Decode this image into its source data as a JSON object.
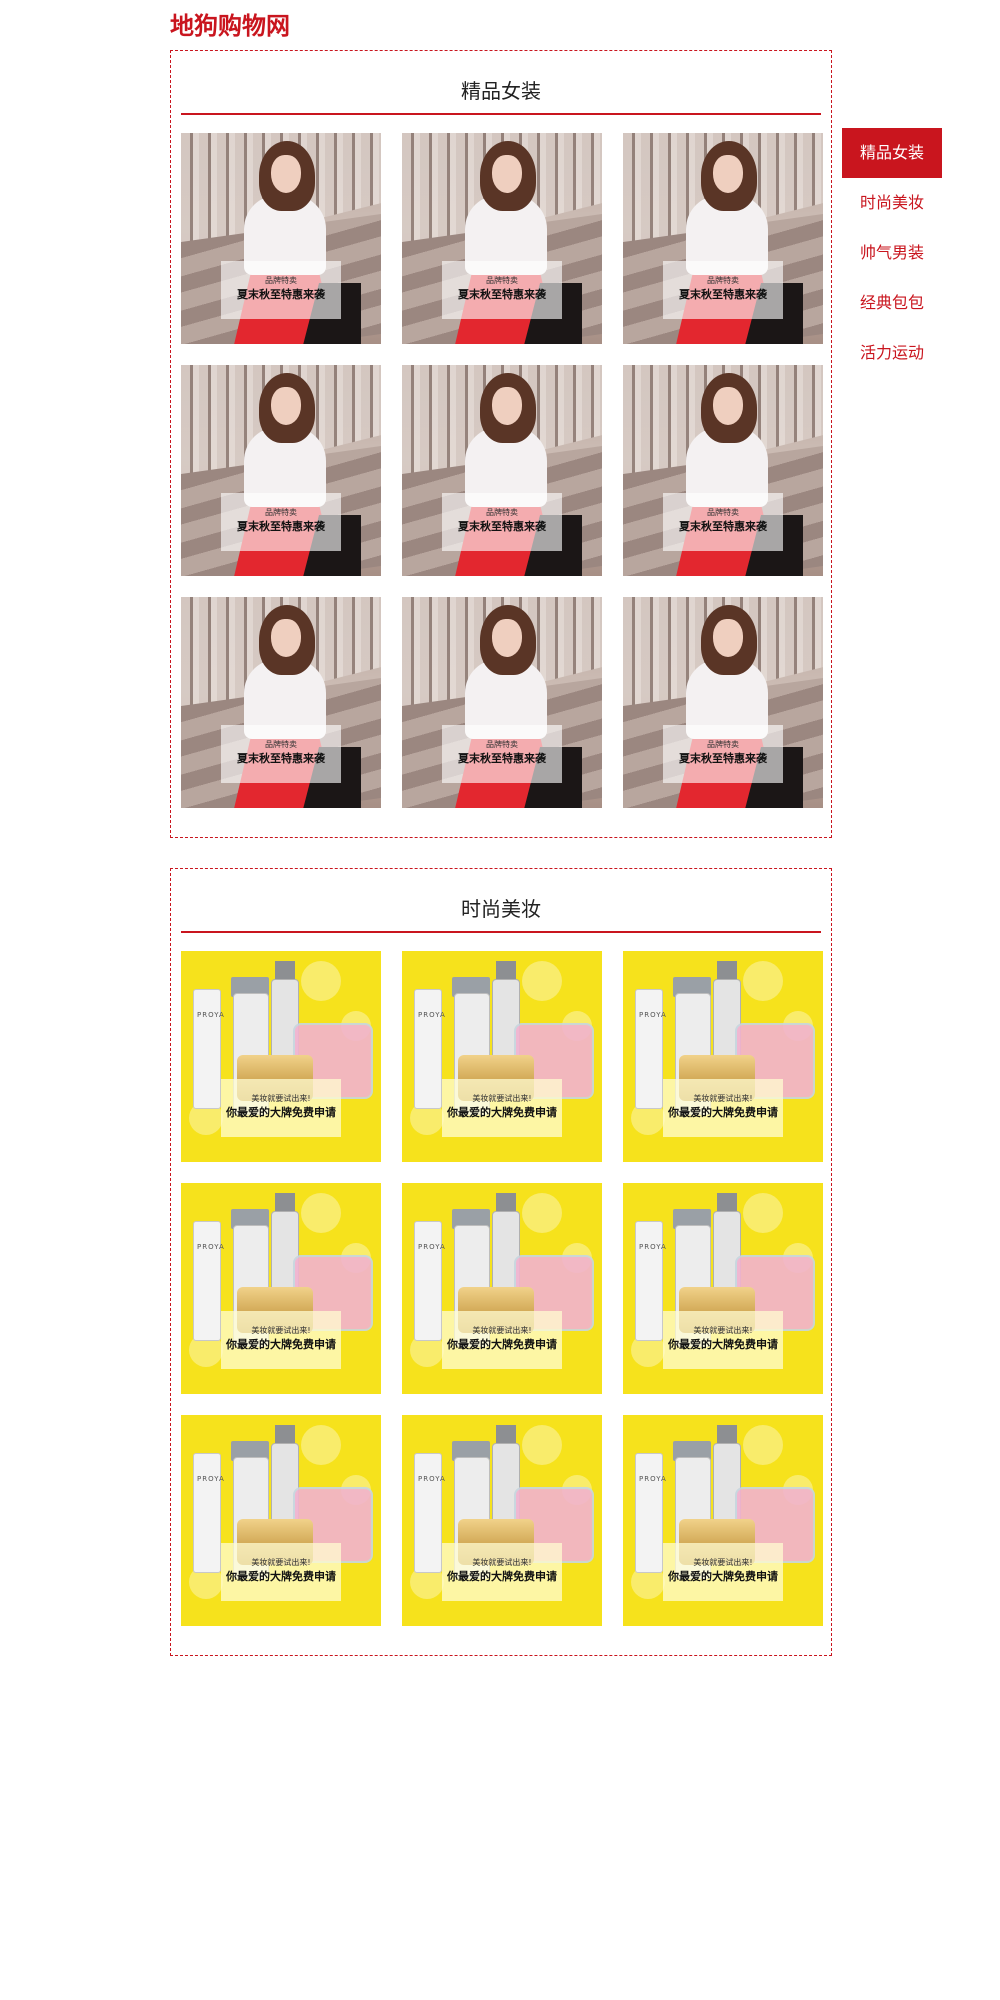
{
  "site": {
    "title": "地狗购物网"
  },
  "nav": {
    "items": [
      {
        "label": "精品女装",
        "active": true
      },
      {
        "label": "时尚美妆",
        "active": false
      },
      {
        "label": "帅气男装",
        "active": false
      },
      {
        "label": "经典包包",
        "active": false
      },
      {
        "label": "活力运动",
        "active": false
      }
    ]
  },
  "sections": [
    {
      "title": "精品女装",
      "card": {
        "small": "品牌特卖",
        "big": "夏末秋至特惠来袭"
      },
      "count": 9
    },
    {
      "title": "时尚美妆",
      "card": {
        "small": "美妆就要试出来!",
        "big": "你最爱的大牌免费申请",
        "brand": "PROYA"
      },
      "count": 9
    }
  ],
  "colors": {
    "accent": "#c9151e",
    "cosmetics_bg": "#f6e21c"
  }
}
